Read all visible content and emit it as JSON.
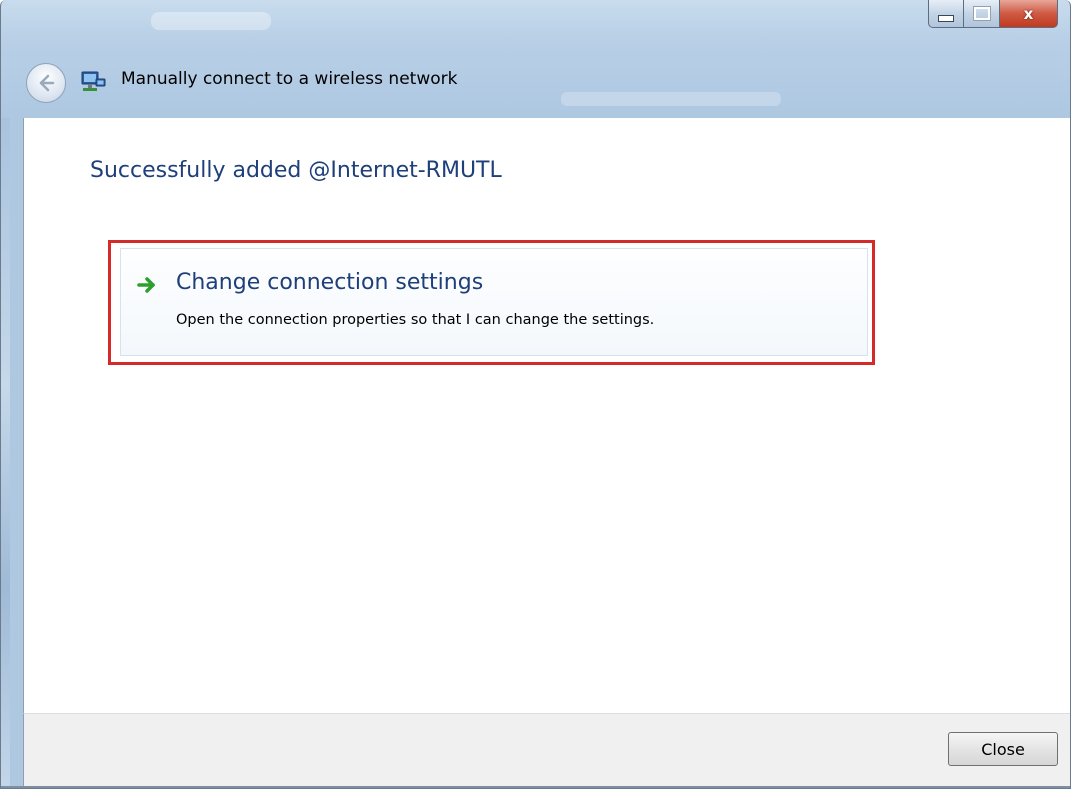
{
  "window": {
    "title": "Manually connect to a wireless network",
    "caption_buttons": {
      "minimize_icon": "minimize-icon",
      "maximize_icon": "maximize-icon",
      "close_glyph": "x"
    }
  },
  "nav": {
    "back_icon": "back-arrow-icon",
    "network_icon": "network-icon"
  },
  "main": {
    "heading": "Successfully added @Internet-RMUTL",
    "option": {
      "icon": "green-arrow-icon",
      "title": "Change connection settings",
      "description": "Open the connection properties so that I can change the settings."
    }
  },
  "footer": {
    "close_label": "Close"
  },
  "colors": {
    "heading_blue": "#1e3f7a",
    "highlight_red": "#d42a2a",
    "arrow_green": "#2e9e2e",
    "footer_bg": "#f0f0f0"
  }
}
